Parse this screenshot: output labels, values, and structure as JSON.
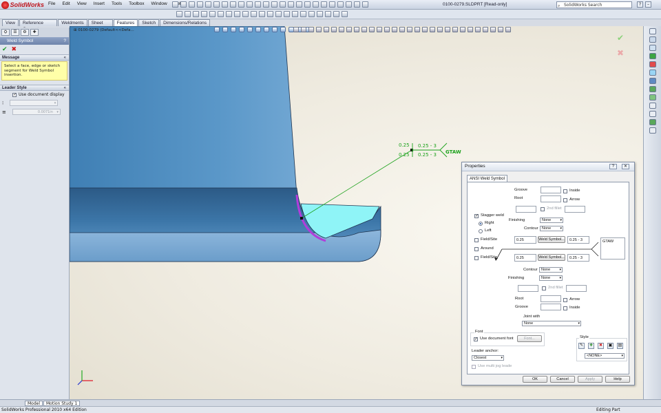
{
  "app": {
    "logo_text": "SolidWorks",
    "document_title": "0100-0279.SLDPRT [Read-only]",
    "search_placeholder": "SolidWorks Search",
    "menus": [
      "File",
      "Edit",
      "View",
      "Insert",
      "Tools",
      "Toolbox",
      "Window",
      "Help"
    ]
  },
  "command_tabs": [
    "View",
    "Reference Geometry",
    "Weldments",
    "Sheet Metal",
    "Features",
    "Sketch",
    "Dimensions/Relations"
  ],
  "active_tab": "Features",
  "property_manager": {
    "title": "Weld Symbol",
    "help": "?",
    "ok_icon": "✔",
    "cancel_icon": "✖",
    "message_header": "Message",
    "message_text": "Select a face, edge or sketch segment for Weld Symbol insertion.",
    "leader_header": "Leader Style",
    "use_document_display": "Use document display",
    "line_value": "0.0071in"
  },
  "tree": {
    "root_label": "0100-0279 (Default<<Defa..."
  },
  "weld_annotation": {
    "upper_size": "0.25",
    "upper_length": "0.25 - 3",
    "lower_size": "0.25",
    "lower_length": "0.25 - 3",
    "process": "GTAW",
    "color": "#1aa11a"
  },
  "dialog": {
    "title": "Properties",
    "tab": "ANSI Weld Symbol",
    "groove_label": "Groove",
    "root_label": "Root",
    "inside_label": "Inside",
    "arrow_label": "Arrow",
    "second_fillet_label": "2nd fillet",
    "stagger_weld_label": "Stagger weld",
    "right_label": "Right",
    "left_label": "Left",
    "finishing_label": "Finishing",
    "contour_label": "Contour",
    "none_value": "None",
    "field_site_label": "Field/Site",
    "around_label": "Around",
    "upper_size": "0.25",
    "upper_weld_symbol_btn": "Weld Symbol...",
    "upper_length": "0.25 - 3",
    "lower_size": "0.25",
    "lower_weld_symbol_btn": "Weld Symbol...",
    "lower_length": "0.25 - 3",
    "process_text": "GTAW",
    "joint_with_label": "Joint with",
    "font_label": "Font",
    "use_document_font": "Use document font",
    "font_btn": "Font...",
    "leader_anchor_label": "Leader anchor:",
    "leader_anchor_value": "Closest",
    "use_multi_jog": "Use multi jog leade",
    "style_label": "Style",
    "style_value": "<NONE>",
    "ok": "OK",
    "cancel": "Cancel",
    "apply": "Apply",
    "help": "Help"
  },
  "bottom_tabs": [
    "Model",
    "Motion Study 1"
  ],
  "status": {
    "left": "SolidWorks Professional 2010 x64 Edition",
    "right": "Editing Part"
  }
}
